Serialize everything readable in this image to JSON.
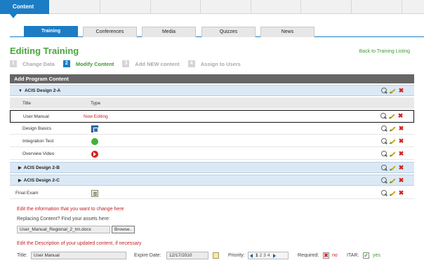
{
  "top_nav": {
    "active_tab": "Content"
  },
  "sub_tabs": [
    "Training",
    "Conferences",
    "Media",
    "Quizzes",
    "News"
  ],
  "page": {
    "title": "Editing Training",
    "back_link": "Back to Training Listing"
  },
  "steps": [
    {
      "num": "1",
      "label": "Change Data"
    },
    {
      "num": "2",
      "label": "Modify Content"
    },
    {
      "num": "3",
      "label": "Add NEW content"
    },
    {
      "num": "4",
      "label": "Assign to Users"
    }
  ],
  "panel": {
    "header": "Add Program Content",
    "group1": "ACIS Design 2-A",
    "col_title": "Title",
    "col_type": "Type",
    "items": [
      {
        "title": "User Manual",
        "status": "Now Editing",
        "icon": "document-icon"
      },
      {
        "title": "Design Basics",
        "icon": "document-icon"
      },
      {
        "title": "Integration Test",
        "icon": "chat-icon"
      },
      {
        "title": "Overview Video",
        "icon": "video-icon"
      }
    ],
    "group2": "ACIS Design 2-B",
    "group3": "ACIS Design 2-C",
    "final": {
      "title": "Final Exam",
      "icon": "exam-icon"
    }
  },
  "form": {
    "note_edit": "Edit the information that you want to change here",
    "replace_label": "Replacing Content? Find your assets here:",
    "file_value": "User_Manual_Regional_2_trn.docx",
    "browse_label": "Browse..",
    "note_desc": "Edit the Description of your updated content, if necessary",
    "title_label": "Title:",
    "title_value": "User Manual",
    "expire_label": "Expire Date:",
    "expire_value": "12/17/2010",
    "priority_label": "Priority:",
    "priority_values": [
      "1",
      "2",
      "3",
      "4"
    ],
    "priority_selected": "1",
    "required_label": "Required:",
    "required_value": "no",
    "itar_label": "ITAR:",
    "itar_value": "yes"
  },
  "colors": {
    "accent_blue": "#1c7cc4",
    "heading_green": "#4aa63c",
    "error_red": "#c22222"
  }
}
